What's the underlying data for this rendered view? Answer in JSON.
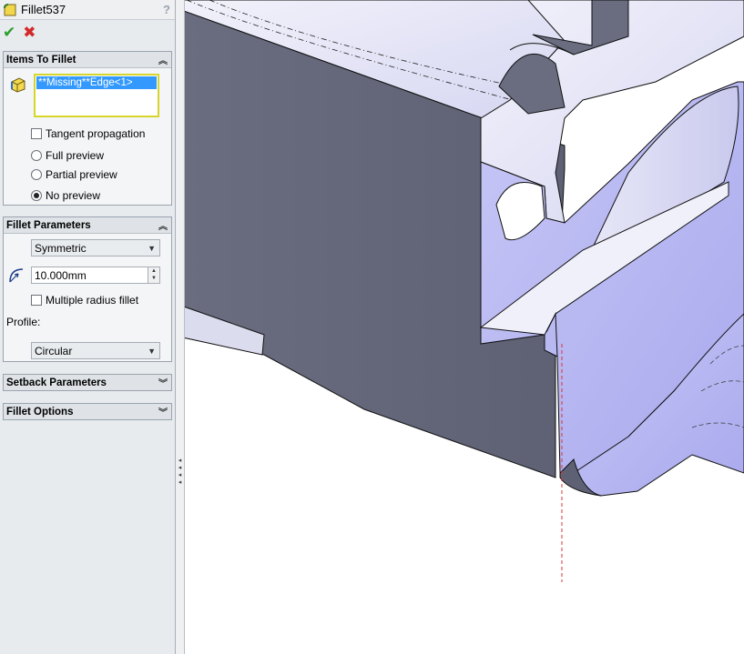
{
  "property_manager": {
    "title": "Fillet537",
    "help_label": "?",
    "ok_label": "✔",
    "cancel_label": "✖"
  },
  "items_to_fillet": {
    "header": "Items To Fillet",
    "selected_item": "**Missing**Edge<1>",
    "tangent_propagation_label": "Tangent propagation",
    "tangent_propagation_checked": false,
    "preview_options": [
      {
        "label": "Full preview",
        "selected": false
      },
      {
        "label": "Partial preview",
        "selected": false
      },
      {
        "label": "No preview",
        "selected": true
      }
    ]
  },
  "fillet_parameters": {
    "header": "Fillet Parameters",
    "type_value": "Symmetric",
    "radius_value": "10.000mm",
    "multiple_radius_label": "Multiple radius fillet",
    "multiple_radius_checked": false,
    "profile_label": "Profile:",
    "profile_value": "Circular"
  },
  "setback_parameters": {
    "header": "Setback Parameters"
  },
  "fillet_options": {
    "header": "Fillet Options"
  },
  "colors": {
    "panel_bg": "#e8ebee",
    "selection_highlight": "#3399ff",
    "selection_box_border": "#d6d62a",
    "part_face_light": "#b8b8f4",
    "part_face_dark": "#6b6e82",
    "ok_green": "#2e9e2e",
    "cancel_red": "#d22a2a"
  },
  "icons": [
    "fillet-feature-icon",
    "help-icon",
    "ok-check-icon",
    "cancel-x-icon",
    "edge-selection-icon",
    "radius-icon",
    "collapse-chevron-icon",
    "expand-chevron-icon",
    "dropdown-arrow-icon",
    "spin-arrows-icon",
    "panel-collapse-grip-icon"
  ]
}
